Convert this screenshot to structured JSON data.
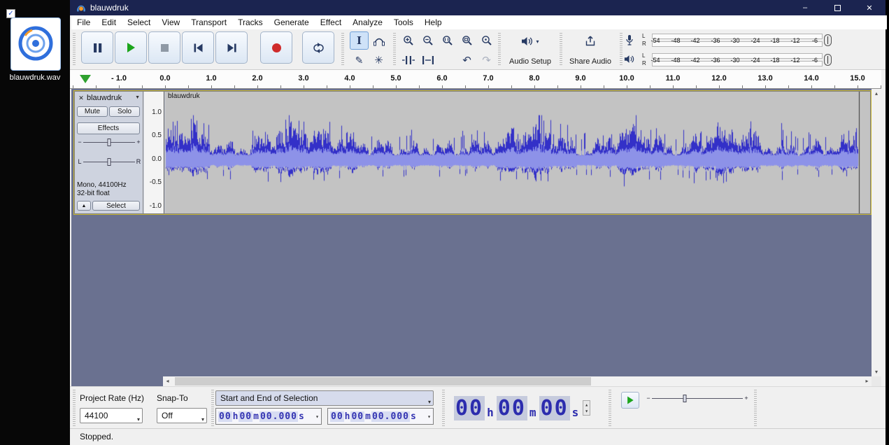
{
  "desktop": {
    "file_label": "blauwdruk.wav"
  },
  "window": {
    "title": "blauwdruk"
  },
  "menu": {
    "items": [
      "File",
      "Edit",
      "Select",
      "View",
      "Transport",
      "Tracks",
      "Generate",
      "Effect",
      "Analyze",
      "Tools",
      "Help"
    ]
  },
  "toolbar": {
    "audio_setup_label": "Audio Setup",
    "share_audio_label": "Share Audio",
    "meter_ticks": [
      "-54",
      "-48",
      "-42",
      "-36",
      "-30",
      "-24",
      "-18",
      "-12",
      "-6"
    ],
    "channel_left": "L",
    "channel_right": "R"
  },
  "timeline": {
    "ticks": [
      "- 1.0",
      "0.0",
      "1.0",
      "2.0",
      "3.0",
      "4.0",
      "5.0",
      "6.0",
      "7.0",
      "8.0",
      "9.0",
      "10.0",
      "11.0",
      "12.0",
      "13.0",
      "14.0",
      "15.0"
    ]
  },
  "track": {
    "name": "blauwdruk",
    "clip_name": "blauwdruk",
    "mute_label": "Mute",
    "solo_label": "Solo",
    "effects_label": "Effects",
    "gain_min": "−",
    "gain_max": "+",
    "pan_left": "L",
    "pan_right": "R",
    "info_line1": "Mono, 44100Hz",
    "info_line2": "32-bit float",
    "select_label": "Select",
    "vruler": [
      "1.0",
      "0.5",
      "0.0",
      "-0.5",
      "-1.0"
    ],
    "duration_seconds": 15,
    "wave_color_dark": "#3330c8",
    "wave_color_light": "#8d92e8"
  },
  "bottom": {
    "project_rate_label": "Project Rate (Hz)",
    "project_rate_value": "44100",
    "snap_label": "Snap-To",
    "snap_value": "Off",
    "selection_mode": "Start and End of Selection",
    "selection_start": {
      "h": "00",
      "m": "00",
      "s": "00.000"
    },
    "selection_end": {
      "h": "00",
      "m": "00",
      "s": "00.000"
    },
    "time_units": {
      "h": "h",
      "m": "m",
      "s": "s"
    },
    "big_time": {
      "h": "00",
      "m": "00",
      "s": "00"
    }
  },
  "status": {
    "text": "Stopped."
  },
  "icons": {
    "check": "✓",
    "minimize": "–",
    "close": "✕",
    "combo_arrow": "▾",
    "spin_up": "▴",
    "spin_down": "▾",
    "track_menu_arrow": "▼",
    "track_close": "✕",
    "collapse": "▲",
    "pencil": "✎",
    "multi_tool": "✳",
    "undo": "↶",
    "redo": "↷",
    "scroll_left": "◂",
    "scroll_right": "▸",
    "scroll_up": "▴",
    "scroll_down": "▾",
    "ibeam": "I"
  }
}
